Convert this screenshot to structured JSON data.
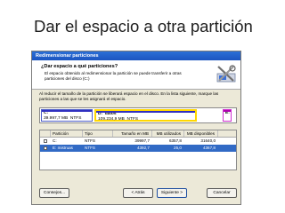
{
  "slide": {
    "title": "Dar el espacio a otra partición"
  },
  "window": {
    "title": "Redimensionar particiones",
    "heading": "¿Dar espacio a qué particiones?",
    "description": "El espacio obtenido al redimensionar la partición se puede transferir a otras particiones del disco (C:)",
    "icon": "resize-partition-icon"
  },
  "info_text": "Al reducir el tamaño de la partición se liberará espacio en el disco. En la lista siguiente, marque las particiones a las que se les asignará el espacio.",
  "disk_map": {
    "c": {
      "label": "C:",
      "size": "39.997,7 MB",
      "fs": "NTFS"
    },
    "d": {
      "label": "D:",
      "name": "datos",
      "size": "109.234,9 MB",
      "fs": "NTFS"
    },
    "e": {
      "label": "E:"
    }
  },
  "table": {
    "headers": [
      "Partición",
      "Tipo",
      "Tamaño en MB",
      "MB utilizados",
      "MB disponibles"
    ],
    "rows": [
      {
        "partition": "C:",
        "type": "NTFS",
        "size": "39997,7",
        "used": "6357,8",
        "free": "31640,0",
        "selected": false
      },
      {
        "partition": "E: mistruas",
        "type": "NTFS",
        "size": "4392,7",
        "used": "25,0",
        "free": "4367,8",
        "selected": true
      }
    ]
  },
  "buttons": {
    "consejos": "Consejos...",
    "atras": "< Atrás",
    "siguiente": "Siguiente >",
    "cancelar": "Cancelar"
  },
  "colors": {
    "titlebar": "#1c54c0",
    "selection": "#316ac5",
    "highlight": "#ffd800"
  }
}
